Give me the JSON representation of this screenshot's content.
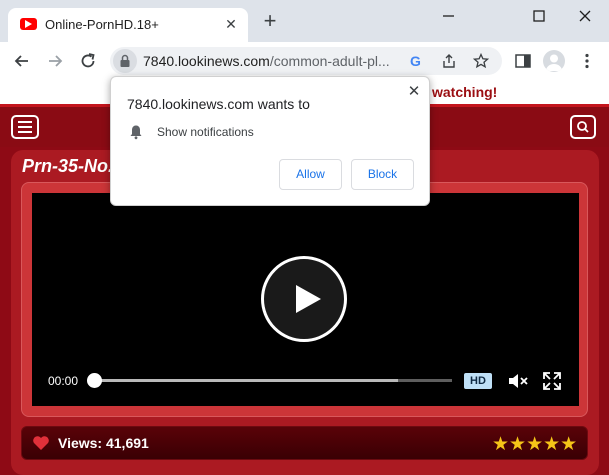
{
  "browser": {
    "tab": {
      "title": "Online-PornHD.18+",
      "favicon": "youtube-icon"
    },
    "address": {
      "host": "7840.lookinews.com",
      "path": "/common-adult-pl..."
    }
  },
  "page": {
    "banner_text": "watching!",
    "video": {
      "title": "Prn-35-No.",
      "current_time": "00:00",
      "progress": 0,
      "buffered": 0.85,
      "quality_badge": "HD"
    },
    "stats": {
      "views": "Views: 41,691",
      "rating_stars": 5
    }
  },
  "permission_prompt": {
    "heading": "7840.lookinews.com wants to",
    "permission": "Show notifications",
    "allow_label": "Allow",
    "block_label": "Block"
  },
  "colors": {
    "page_bg": "#8e0a15",
    "card": "#ab1a22",
    "star": "#f5c518",
    "link_blue": "#1a73e8"
  }
}
